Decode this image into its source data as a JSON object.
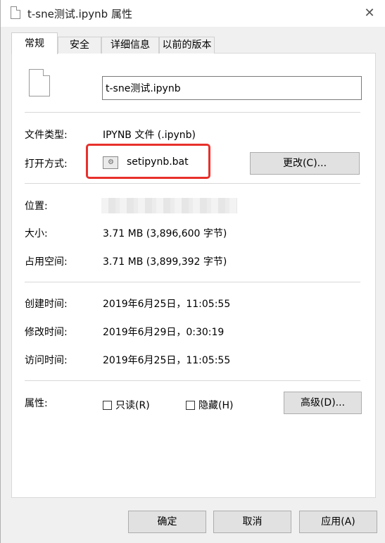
{
  "window": {
    "title": "t-sne测试.ipynb 属性",
    "close_glyph": "✕"
  },
  "tabs": [
    {
      "label": "常规",
      "active": true
    },
    {
      "label": "安全",
      "active": false
    },
    {
      "label": "详细信息",
      "active": false
    },
    {
      "label": "以前的版本",
      "active": false
    }
  ],
  "general": {
    "file_name": "t-sne测试.ipynb",
    "file_type_label": "文件类型:",
    "file_type_value": "IPYNB 文件 (.ipynb)",
    "open_with_label": "打开方式:",
    "open_with_value": "setipynb.bat",
    "change_button": "更改(C)...",
    "location_label": "位置:",
    "size_label": "大小:",
    "size_value": "3.71 MB (3,896,600 字节)",
    "size_on_disk_label": "占用空间:",
    "size_on_disk_value": "3.71 MB (3,899,392 字节)",
    "created_label": "创建时间:",
    "created_value": "2019年6月25日，11:05:55",
    "modified_label": "修改时间:",
    "modified_value": "2019年6月29日，0:30:19",
    "accessed_label": "访问时间:",
    "accessed_value": "2019年6月25日，11:05:55",
    "attributes_label": "属性:",
    "readonly_label": "只读(R)",
    "readonly_checked": false,
    "hidden_label": "隐藏(H)",
    "hidden_checked": false,
    "advanced_button": "高级(D)..."
  },
  "footer": {
    "ok": "确定",
    "cancel": "取消",
    "apply": "应用(A)"
  },
  "colors": {
    "highlight_box": "#e8302b",
    "panel_bg": "#ffffff",
    "window_bg": "#f0f0f0"
  },
  "icons": {
    "title": "file-icon",
    "file": "file-icon",
    "open_with": "bat-file-icon",
    "close": "close-icon"
  }
}
